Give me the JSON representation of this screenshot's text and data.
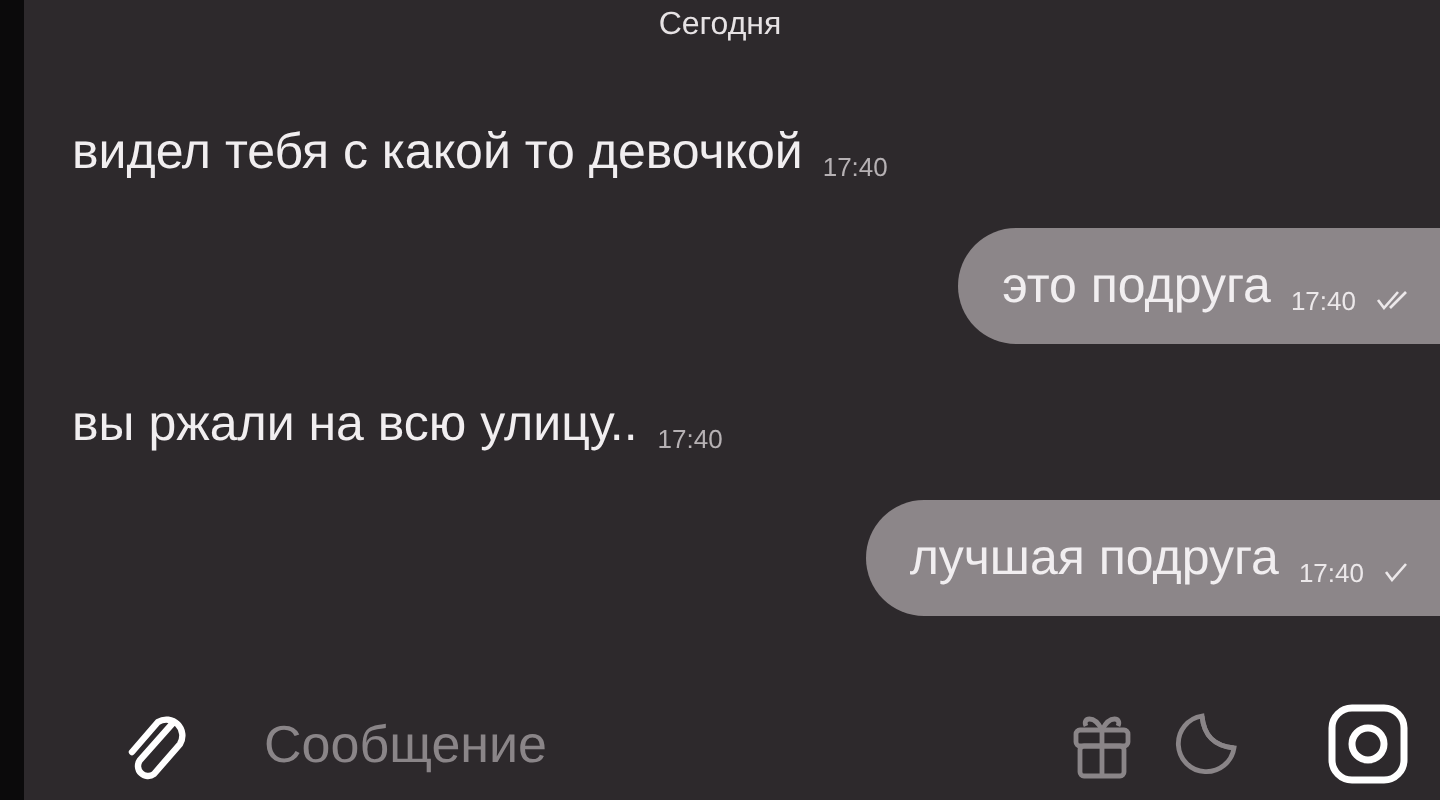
{
  "date_header": "Сегодня",
  "messages": [
    {
      "kind": "incoming",
      "text": "видел тебя с какой то девочкой",
      "time": "17:40"
    },
    {
      "kind": "outgoing",
      "text": "это подруга",
      "time": "17:40",
      "read": true
    },
    {
      "kind": "incoming",
      "text": "вы ржали на всю улицу..",
      "time": "17:40"
    },
    {
      "kind": "outgoing",
      "text": "лучшая подруга",
      "time": "17:40",
      "read": false
    }
  ],
  "composer": {
    "placeholder": "Сообщение"
  }
}
